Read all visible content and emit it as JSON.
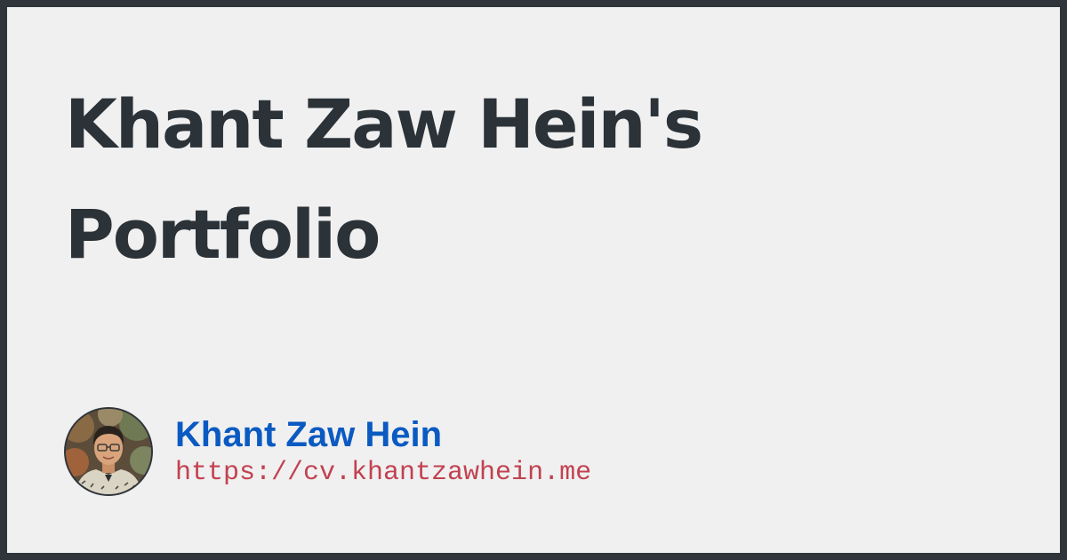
{
  "title_line1": "Khant Zaw Hein's",
  "title_line2": "Portfolio",
  "author": {
    "name": "Khant Zaw Hein",
    "url": "https://cv.khantzawhein.me",
    "avatar_icon": "profile-photo-avatar"
  },
  "colors": {
    "frame": "#2f353b",
    "background": "#f0f0f0",
    "title": "#2b3238",
    "name": "#0a5ac2",
    "url": "#c24251"
  }
}
